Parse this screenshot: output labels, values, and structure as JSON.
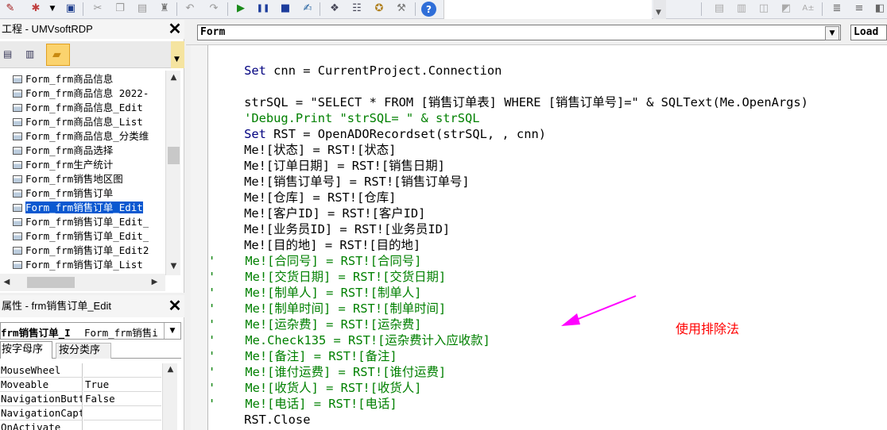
{
  "project_panel": {
    "title": "工程 - UMVsoftRDP",
    "tree_items": [
      "Form_frm商品信息",
      "Form_frm商品信息 2022-",
      "Form_frm商品信息_Edit",
      "Form_frm商品信息_List",
      "Form_frm商品信息_分类维",
      "Form_frm商品选择",
      "Form_frm生产统计",
      "Form_frm销售地区图",
      "Form_frm销售订单",
      "Form_frm销售订单_Edit",
      "Form_frm销售订单_Edit_",
      "Form_frm销售订单_Edit_",
      "Form_frm销售订单_Edit2",
      "Form_frm销售订单_List"
    ],
    "selected_index": 9
  },
  "properties_panel": {
    "title": "属性 - frm销售订单_Edit",
    "object_name": "frm销售订单_I",
    "object_type": "Form_frm销售i",
    "tabs": [
      "按字母序",
      "按分类序"
    ],
    "rows": [
      {
        "name": "MouseWheel",
        "value": ""
      },
      {
        "name": "Moveable",
        "value": "True"
      },
      {
        "name": "NavigationButtons",
        "value": "False"
      },
      {
        "name": "NavigationCaption",
        "value": ""
      },
      {
        "name": "OnActivate",
        "value": ""
      }
    ]
  },
  "code_window": {
    "object_combo": "Form",
    "procedure_combo": "Load",
    "lines": [
      {
        "text": "    Set cnn = CurrentProject.Connection",
        "type": "code"
      },
      {
        "text": "",
        "type": "code"
      },
      {
        "text": "    strSQL = \"SELECT * FROM [销售订单表] WHERE [销售订单号]=\" & SQLText(Me.OpenArgs)",
        "type": "code"
      },
      {
        "text": "    'Debug.Print \"strSQL= \" & strSQL",
        "type": "comment"
      },
      {
        "text": "    Set RST = OpenADORecordset(strSQL, , cnn)",
        "type": "code"
      },
      {
        "text": "    Me![状态] = RST![状态]",
        "type": "code"
      },
      {
        "text": "    Me![订单日期] = RST![销售日期]",
        "type": "code"
      },
      {
        "text": "    Me![销售订单号] = RST![销售订单号]",
        "type": "code"
      },
      {
        "text": "    Me![仓库] = RST![仓库]",
        "type": "code"
      },
      {
        "text": "    Me![客户ID] = RST![客户ID]",
        "type": "code"
      },
      {
        "text": "    Me![业务员ID] = RST![业务员ID]",
        "type": "code"
      },
      {
        "text": "    Me![目的地] = RST![目的地]",
        "type": "code"
      },
      {
        "text": "'    Me![合同号] = RST![合同号]",
        "type": "comment"
      },
      {
        "text": "'    Me![交货日期] = RST![交货日期]",
        "type": "comment"
      },
      {
        "text": "'    Me![制单人] = RST![制单人]",
        "type": "comment"
      },
      {
        "text": "'    Me![制单时间] = RST![制单时间]",
        "type": "comment"
      },
      {
        "text": "'    Me![运杂费] = RST![运杂费]",
        "type": "comment"
      },
      {
        "text": "'    Me.Check135 = RST![运杂费计入应收款]",
        "type": "comment"
      },
      {
        "text": "'    Me![备注] = RST![备注]",
        "type": "comment"
      },
      {
        "text": "'    Me![谁付运费] = RST![谁付运费]",
        "type": "comment"
      },
      {
        "text": "'    Me![收货人] = RST![收货人]",
        "type": "comment"
      },
      {
        "text": "'    Me![电话] = RST![电话]",
        "type": "comment"
      },
      {
        "text": "    RST.Close",
        "type": "code"
      }
    ],
    "annotation": "使用排除法",
    "annotation_color": "#ff0000",
    "arrow_color": "#ff00ff"
  },
  "colors": {
    "keyword": "#00007f",
    "comment": "#008000",
    "selection": "#0a58d0"
  },
  "toolbar_icons": [
    "vba-icon",
    "insert-icon",
    "save-icon",
    "cut-icon",
    "copy-icon",
    "paste-icon",
    "find-icon",
    "undo-icon",
    "redo-icon",
    "run-icon",
    "break-icon",
    "reset-icon",
    "design-mode-icon",
    "project-explorer-icon",
    "properties-icon",
    "object-browser-icon",
    "toolbox-icon",
    "help-icon"
  ]
}
